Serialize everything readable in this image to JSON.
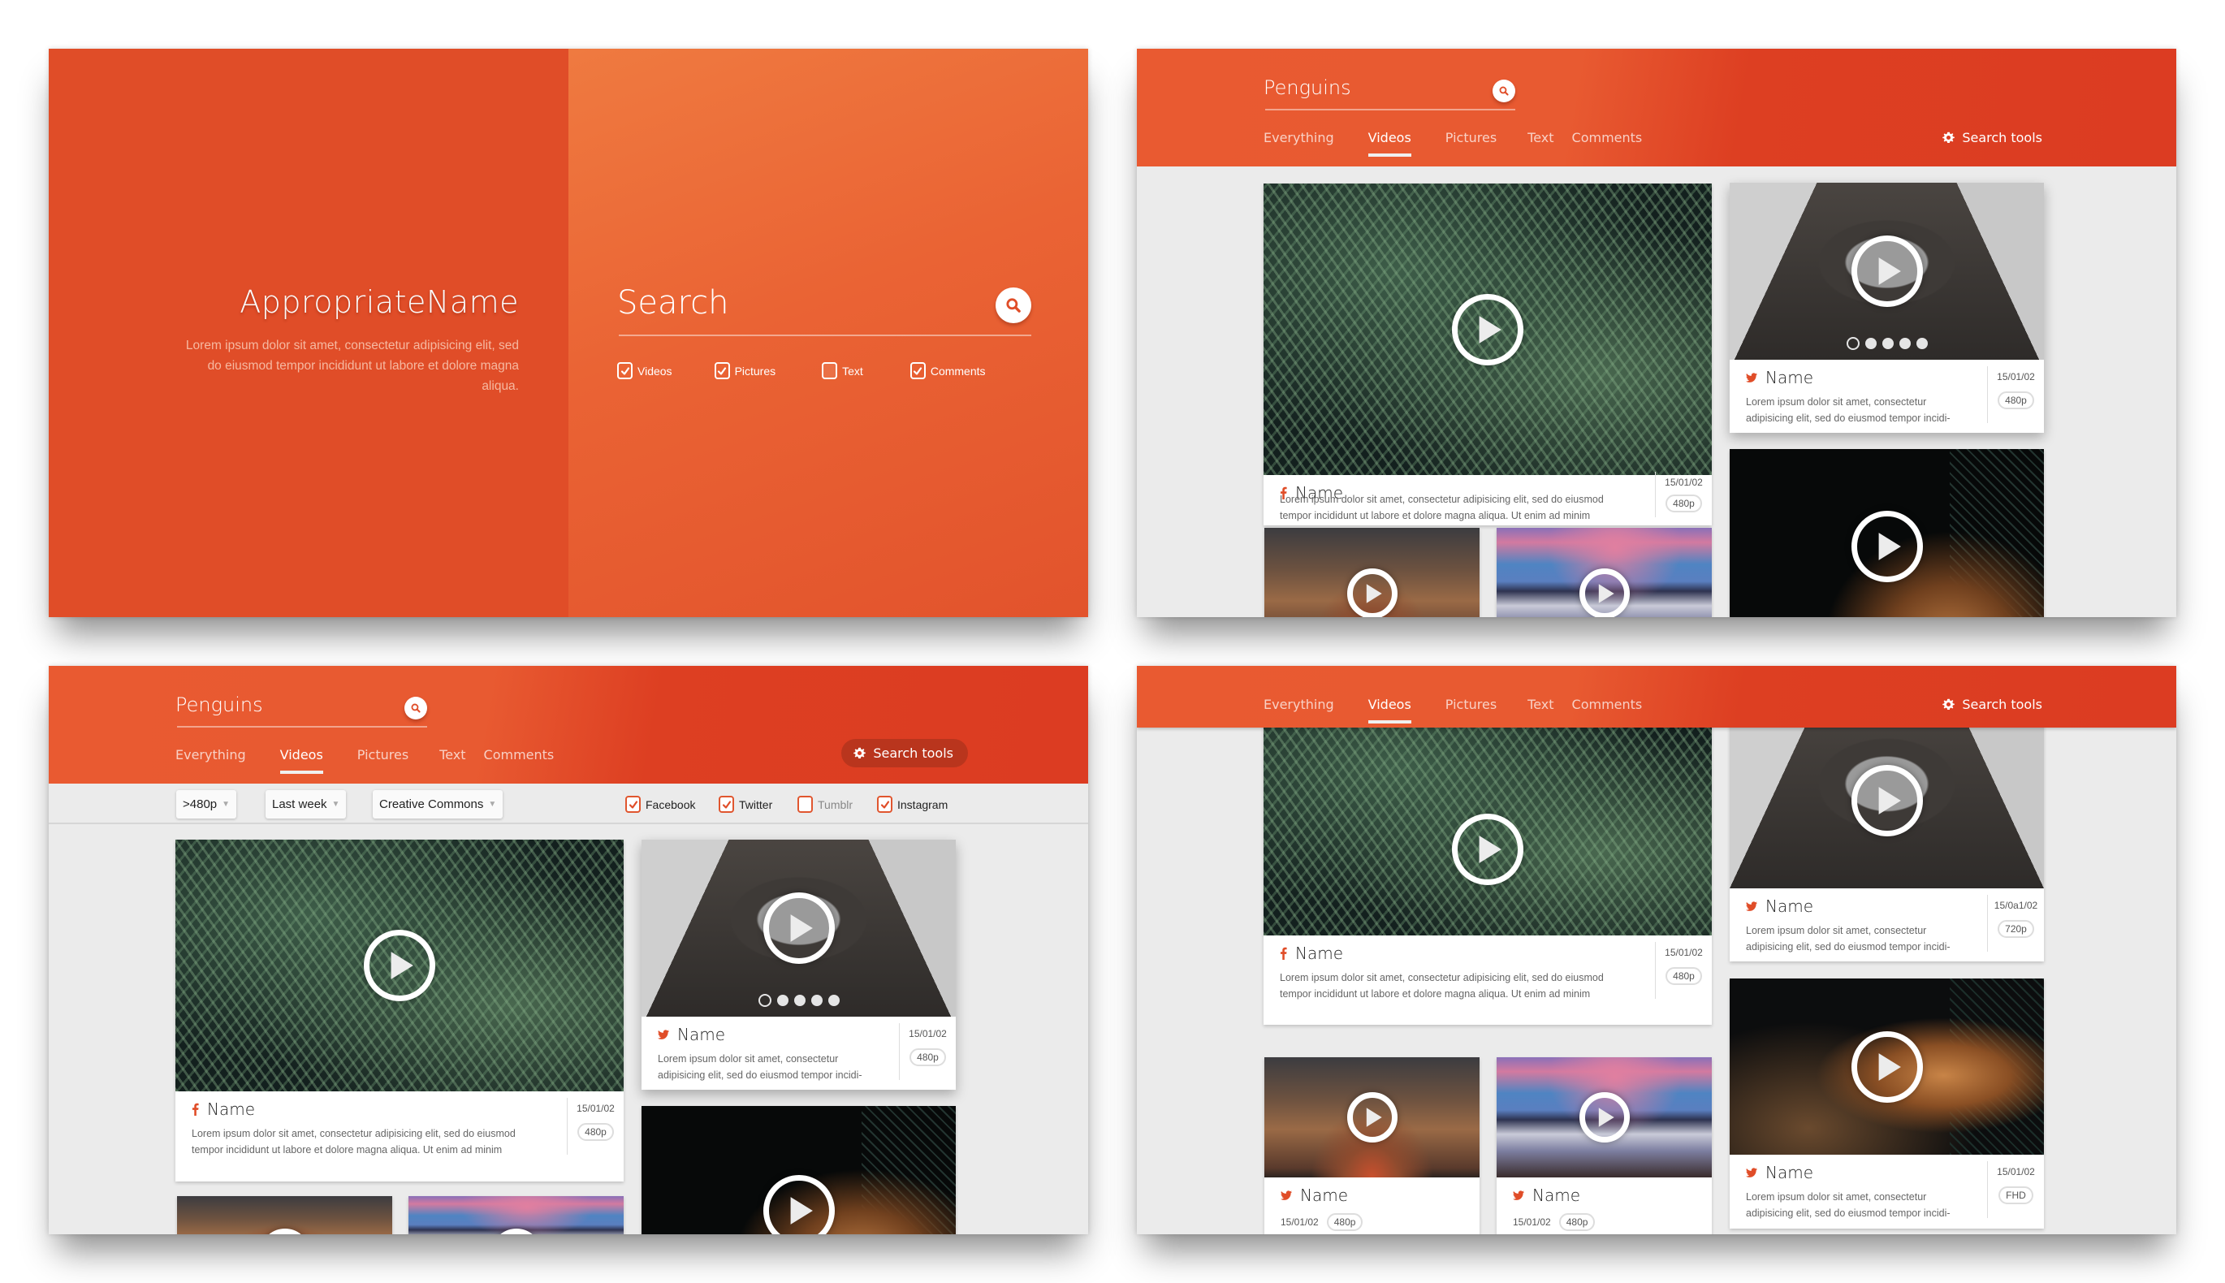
{
  "colors": {
    "accent": "#e04d28",
    "accent_dark": "#dc3c22",
    "background": "#ebebeb",
    "card": "#ffffff"
  },
  "landing": {
    "brand_title": "AppropriateName",
    "brand_description": "Lorem ipsum dolor sit amet, consectetur adipisicing elit, sed do eiusmod tempor incididunt ut labore et dolore magna aliqua.",
    "search_placeholder": "Search",
    "search_icon": "search-icon",
    "filters": [
      {
        "label": "Videos",
        "checked": true
      },
      {
        "label": "Pictures",
        "checked": true
      },
      {
        "label": "Text",
        "checked": false
      },
      {
        "label": "Comments",
        "checked": true
      }
    ]
  },
  "results_header": {
    "query": "Penguins",
    "tabs": [
      "Everything",
      "Videos",
      "Pictures",
      "Text",
      "Comments"
    ],
    "active_tab": "Videos",
    "search_tools_label": "Search tools",
    "search_tools_icon": "gear-icon"
  },
  "filter_bar": {
    "dropdowns": [
      {
        "selected": ">480p"
      },
      {
        "selected": "Last week"
      },
      {
        "selected": "Creative Commons"
      }
    ],
    "sources": [
      {
        "label": "Facebook",
        "checked": true
      },
      {
        "label": "Twitter",
        "checked": true
      },
      {
        "label": "Tumblr",
        "checked": false
      },
      {
        "label": "Instagram",
        "checked": true
      }
    ]
  },
  "cards": {
    "fern": {
      "source": "facebook",
      "name": "Name",
      "description": "Lorem ipsum dolor sit amet, consectetur adipisicing elit, sed do eiusmod tempor incididunt ut labore et dolore magna aliqua. Ut enim ad minim",
      "date": "15/01/02",
      "quality": "480p"
    },
    "attic": {
      "source": "twitter",
      "name": "Name",
      "description": "Lorem ipsum dolor sit amet, consectetur adipisicing elit, sed do eiusmod tempor incidi-",
      "date": "15/01/02",
      "quality": "480p",
      "carousel_count": 5,
      "carousel_current": 1
    },
    "attic_v2": {
      "source": "twitter",
      "name": "Name",
      "description": "Lorem ipsum dolor sit amet, consectetur adipisicing elit, sed do eiusmod tempor incidi-",
      "date": "15/0a1/02",
      "quality": "720p"
    },
    "sunset": {
      "source": "twitter",
      "name": "Name",
      "date": "15/01/02",
      "quality": "480p"
    },
    "volcano": {
      "source": "twitter",
      "name": "Name",
      "date": "15/01/02",
      "quality": "480p"
    },
    "tiger": {
      "source": "twitter",
      "name": "Name",
      "description": "Lorem ipsum dolor sit amet, consectetur adipisicing elit, sed do eiusmod tempor incidi-",
      "date": "15/01/02",
      "quality": "FHD"
    }
  }
}
